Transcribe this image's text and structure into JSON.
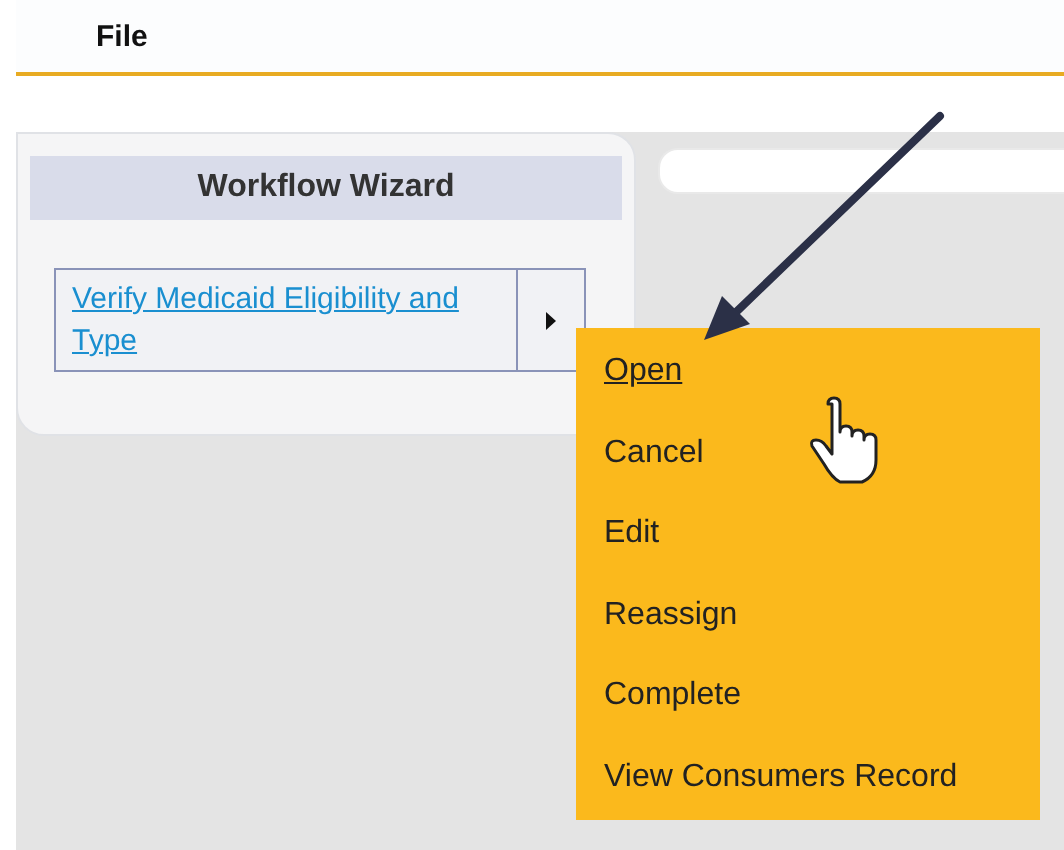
{
  "menu_bar": {
    "items": [
      "File"
    ]
  },
  "workflow_wizard": {
    "title": "Workflow Wizard",
    "task": {
      "label": "Verify Medicaid Eligibility and Type",
      "expanded": true
    }
  },
  "context_menu": {
    "items": [
      {
        "label": "Open",
        "hovered": true
      },
      {
        "label": "Cancel",
        "hovered": false
      },
      {
        "label": "Edit",
        "hovered": false
      },
      {
        "label": "Reassign",
        "hovered": false
      },
      {
        "label": "Complete",
        "hovered": false
      },
      {
        "label": "View Consumers Record",
        "hovered": false
      }
    ]
  }
}
